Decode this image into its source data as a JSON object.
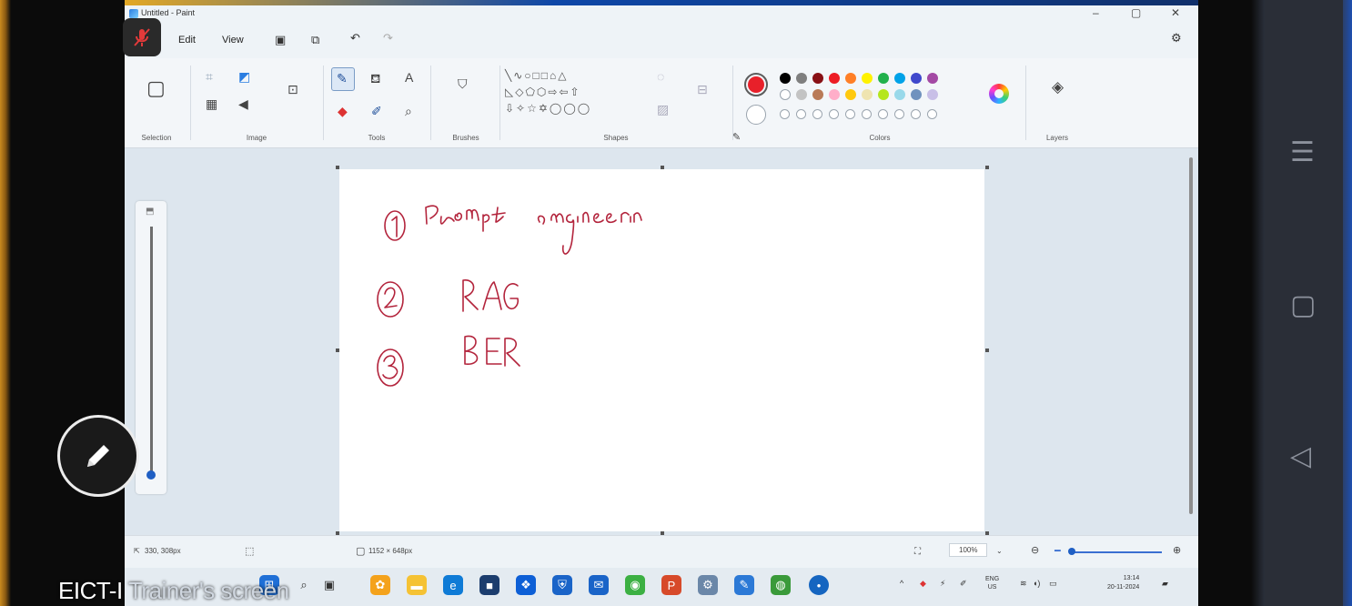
{
  "window": {
    "title": "Untitled - Paint",
    "minimize": "–",
    "maximize": "▢",
    "close": "✕"
  },
  "menu": {
    "edit": "Edit",
    "view": "View"
  },
  "ribbon": {
    "groups": {
      "selection": "Selection",
      "image": "Image",
      "tools": "Tools",
      "brushes": "Brushes",
      "shapes": "Shapes",
      "colors": "Colors",
      "layers": "Layers"
    }
  },
  "colors": {
    "current_primary": "#e8202a",
    "current_secondary": "#ffffff",
    "row1": [
      "#000000",
      "#7f7f7f",
      "#881015",
      "#ed1c24",
      "#ff7f27",
      "#fff200",
      "#22b14c",
      "#00a2e8",
      "#3f48cc",
      "#a349a4"
    ],
    "row2": [
      "#ffffff",
      "#c3c3c3",
      "#b97a57",
      "#ffaec9",
      "#ffc90e",
      "#efe4b0",
      "#b5e61d",
      "#99d9ea",
      "#7092be",
      "#c8bfe7"
    ]
  },
  "canvas": {
    "drawing": [
      {
        "number": "1",
        "text": "Prompt engineering"
      },
      {
        "number": "2",
        "text": "RAG"
      },
      {
        "number": "3",
        "text": "BER"
      }
    ],
    "ink_color": "#b3243c"
  },
  "status": {
    "cursor": "330, 308px",
    "size": "1152 × 648px",
    "zoom": "100%"
  },
  "taskbar": {
    "lang_top": "ENG",
    "lang_bottom": "US",
    "time": "13:14",
    "date": "20-11-2024"
  },
  "overlay": {
    "participant_name_a": "EICT-I",
    "participant_name_b": "Trainer's",
    "participant_name_c": "screen"
  }
}
